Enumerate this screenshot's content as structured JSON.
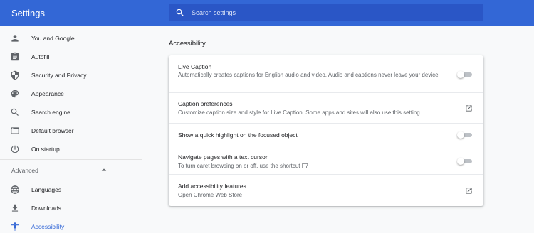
{
  "header": {
    "title": "Settings",
    "search_placeholder": "Search settings",
    "bg_color": "#3367d6"
  },
  "sidebar": {
    "items": [
      {
        "label": "You and Google",
        "icon": "person-icon"
      },
      {
        "label": "Autofill",
        "icon": "clipboard-icon"
      },
      {
        "label": "Security and Privacy",
        "icon": "shield-icon"
      },
      {
        "label": "Appearance",
        "icon": "palette-icon"
      },
      {
        "label": "Search engine",
        "icon": "search-icon"
      },
      {
        "label": "Default browser",
        "icon": "browser-icon"
      },
      {
        "label": "On startup",
        "icon": "power-icon"
      }
    ],
    "advanced_label": "Advanced",
    "advanced_items": [
      {
        "label": "Languages",
        "icon": "globe-icon"
      },
      {
        "label": "Downloads",
        "icon": "download-icon"
      },
      {
        "label": "Accessibility",
        "icon": "accessibility-icon",
        "active": true
      }
    ]
  },
  "main": {
    "section_title": "Accessibility",
    "rows": [
      {
        "title": "Live Caption",
        "description": "Automatically creates captions for English audio and video. Audio and captions never leave your device.",
        "control": "toggle",
        "on": false
      },
      {
        "title": "Caption preferences",
        "description": "Customize caption size and style for Live Caption. Some apps and sites will also use this setting.",
        "control": "external-link"
      },
      {
        "title": "Show a quick highlight on the focused object",
        "description": "",
        "control": "toggle",
        "on": false
      },
      {
        "title": "Navigate pages with a text cursor",
        "description": "To turn caret browsing on or off, use the shortcut F7",
        "control": "toggle",
        "on": false
      },
      {
        "title": "Add accessibility features",
        "description": "Open Chrome Web Store",
        "control": "external-link"
      }
    ]
  }
}
